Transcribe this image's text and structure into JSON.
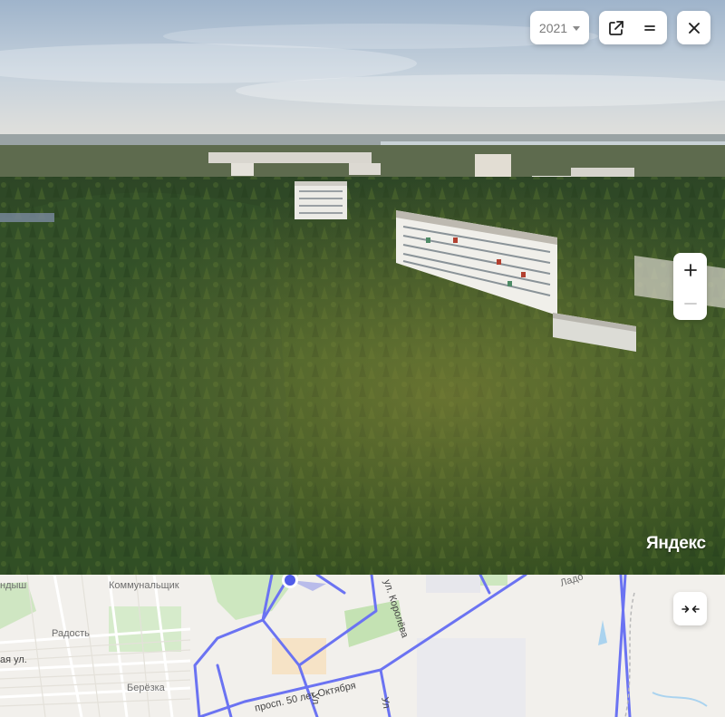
{
  "panorama": {
    "year_select": {
      "value": "2021"
    },
    "brand": "Яндекс"
  },
  "map": {
    "districts": {
      "a": "ндыш",
      "b": "Коммунальщик",
      "c": "Радость",
      "d": "Берёзка",
      "e": "Ладо"
    },
    "streets": {
      "main": "просп. 50 лет Октября",
      "korolev": "ул. Королёва",
      "side": "ая ул.",
      "small": "Ул",
      "small2": "Ул"
    }
  },
  "icons": {
    "year_caret": "chevron-down-icon",
    "open_external": "external-link-icon",
    "menu": "equals-icon",
    "close": "close-icon",
    "zoom_in": "plus-icon",
    "zoom_out": "minus-icon",
    "collapse": "collapse-arrows-icon",
    "location_marker": "location-marker-icon"
  },
  "colors": {
    "route": "#6b73f2",
    "marker": "#4f5be8"
  }
}
